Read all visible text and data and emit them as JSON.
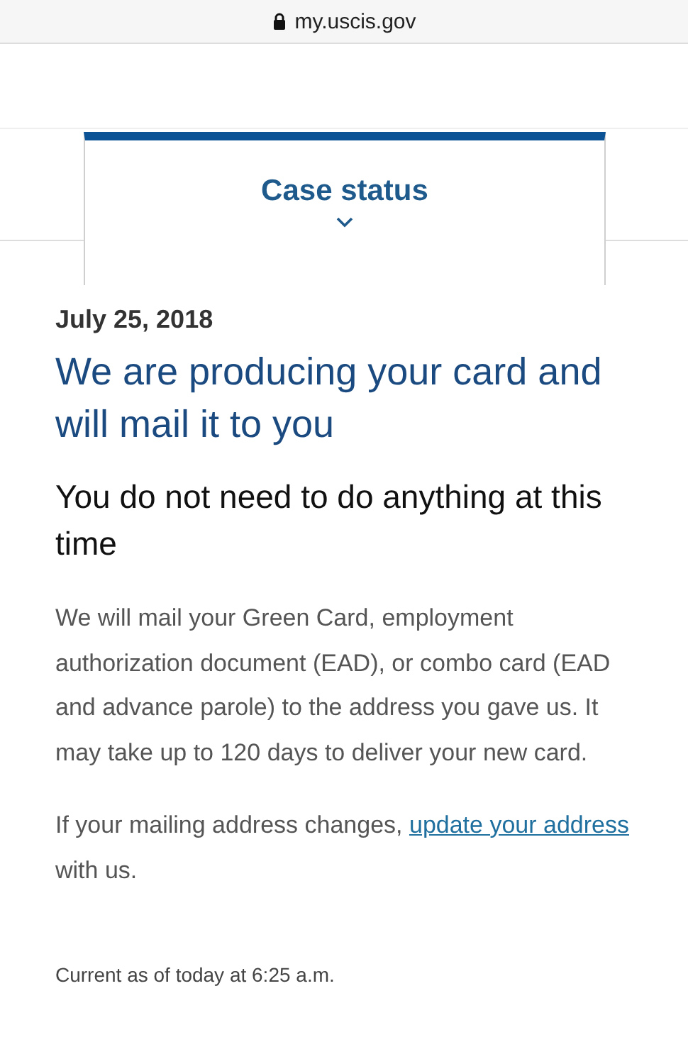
{
  "browser": {
    "url": "my.uscis.gov"
  },
  "tab": {
    "label": "Case status"
  },
  "status": {
    "date": "July 25, 2018",
    "headline": "We are producing your card and will mail it to you",
    "subheading": "You do not need to do anything at this time",
    "paragraphs": [
      {
        "text": "We will mail your Green Card, employment authorization document (EAD), or combo card (EAD and advance parole) to the address you gave us. It may take up to 120 days to deliver your new card."
      },
      {
        "text": "If your mailing address changes,",
        "link": "update your address",
        "after": "with us."
      }
    ],
    "footer": "Current as of today at 6:25 a.m."
  }
}
